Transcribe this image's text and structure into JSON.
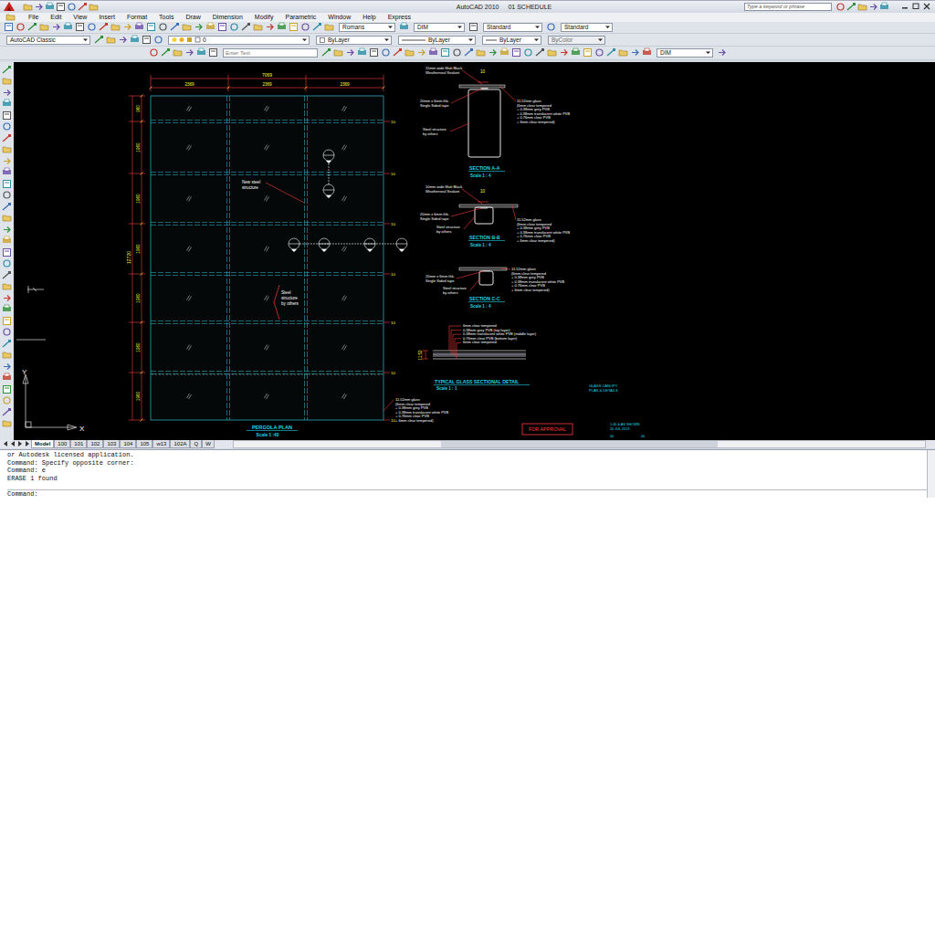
{
  "window": {
    "title": "AutoCAD 2010",
    "document": "01 SCHEDULE"
  },
  "search": {
    "placeholder": "Type a keyword or phrase"
  },
  "menu": [
    "File",
    "Edit",
    "View",
    "Insert",
    "Format",
    "Tools",
    "Draw",
    "Dimension",
    "Modify",
    "Parametric",
    "Window",
    "Help",
    "Express"
  ],
  "styles_toolbar": [
    {
      "label": "Romans",
      "disabled": false
    },
    {
      "label": "DIM",
      "disabled": false
    },
    {
      "label": "Standard",
      "disabled": false
    },
    {
      "label": "Standard",
      "disabled": false
    }
  ],
  "properties_toolbar": {
    "workspace": "AutoCAD Classic",
    "layer": "0",
    "items": [
      {
        "label": "ByLayer",
        "disabled": false
      },
      {
        "label": "ByLayer",
        "disabled": false
      },
      {
        "label": "ByLayer",
        "disabled": false
      },
      {
        "label": "ByColor",
        "disabled": true
      }
    ]
  },
  "text_toolbar": {
    "placeholder": "Enter Text",
    "dim_style": "DIM"
  },
  "drawing": {
    "plan": {
      "overall_width": "7069",
      "bay_widths": [
        "2369",
        "2369",
        "2369"
      ],
      "overall_length": "12720",
      "row_heights": [
        "960",
        "1960",
        "1960",
        "1960",
        "1960",
        "1960",
        "1960"
      ],
      "grid_tags": [
        "10",
        "10",
        "10",
        "10",
        "10",
        "10",
        "10"
      ],
      "labels": [
        {
          "lines": [
            "New steel",
            "structure"
          ]
        },
        {
          "lines": [
            "Steel",
            "structure",
            "by others"
          ]
        }
      ],
      "glass_note": [
        "11.52mm glass",
        "(6mm clear tempered",
        "+ 0.38mm grey PVB",
        "+ 0.38mm translucent white PVB",
        "+ 0.76mm clear PVB",
        "+ 6mm clear tempered)"
      ],
      "title": "PERGOLA PLAN",
      "scale": "Scale 1 :40"
    },
    "sections": [
      {
        "title": "SECTION A-A",
        "scale": "Scale 1 : 4",
        "sealant": [
          "15mm wide Matt Black",
          "Weatherseal Sealant"
        ],
        "gap": "10",
        "tape": [
          "20mm x 6mm thk.",
          "Single Sided tape"
        ],
        "steel": [
          "Steel structure",
          "by others"
        ],
        "glass_note": [
          "11.52mm glass",
          "(6mm clear tempered",
          "+ 0.38mm grey PVB",
          "+ 0.38mm translucent white PVB",
          "+ 0.76mm clear PVB",
          "+ 6mm clear tempered)"
        ]
      },
      {
        "title": "SECTION B-B",
        "scale": "Scale 1 : 4",
        "sealant": [
          "10mm wide Matt Black",
          "Weatherseal Sealant"
        ],
        "gap": "10",
        "tape": [
          "20mm x 6mm thk.",
          "Single Sided tape"
        ],
        "steel": [
          "Steel structure",
          "by others"
        ],
        "glass_note": [
          "11.52mm glass",
          "(6mm clear tempered",
          "+ 0.38mm grey PVB",
          "+ 0.38mm translucent white PVB",
          "+ 0.76mm clear PVB",
          "+ 6mm clear tempered)"
        ]
      },
      {
        "title": "SECTION C-C",
        "scale": "Scale 1 : 4",
        "tape": [
          "20mm x 6mm thk.",
          "Single Sided tape"
        ],
        "steel": [
          "Steel structure",
          "by others"
        ],
        "glass_note": [
          "11.52mm glass",
          "(6mm clear tempered",
          "+ 0.38mm grey PVB",
          "+ 0.38mm translucent white PVB",
          "+ 0.76mm clear PVB",
          "+ 6mm clear tempered)"
        ]
      }
    ],
    "typical": {
      "title": "TYPICAL GLASS SECTIONAL DETAIL",
      "scale": "Scale 1 : 1",
      "thickness": "11.52",
      "layers": [
        "6mm clear tempered",
        "0.38mm grey PVB (top layer)",
        "0.38mm translucent white PVB (middle layer)",
        "0.76mm clear PVB (bottom layer)",
        "6mm clear tempered"
      ]
    },
    "title_block": {
      "name": [
        "GLASS CANOPY",
        "PLAN & DETAILS"
      ],
      "status": "FOR APPROVAL",
      "scale": "1:40 & AS SHOWN",
      "date": "20 JUL 2013",
      "drawing_no": "00",
      "revision": "00"
    },
    "ucs": {
      "x": "X",
      "y": "Y"
    }
  },
  "layout_tabs": [
    {
      "label": "Model",
      "selected": true
    },
    {
      "label": "100",
      "selected": false
    },
    {
      "label": "101",
      "selected": false
    },
    {
      "label": "102",
      "selected": false
    },
    {
      "label": "103",
      "selected": false
    },
    {
      "label": "104",
      "selected": false
    },
    {
      "label": "105",
      "selected": false
    },
    {
      "label": "w13",
      "selected": false
    },
    {
      "label": "102A",
      "selected": false
    },
    {
      "label": "Q",
      "selected": false
    },
    {
      "label": "W",
      "selected": false
    }
  ],
  "command_history": [
    "or Autodesk licensed application.",
    "Command: Specify opposite corner:",
    "Command: e",
    "ERASE 1 found"
  ],
  "command_prompt": "Command:"
}
